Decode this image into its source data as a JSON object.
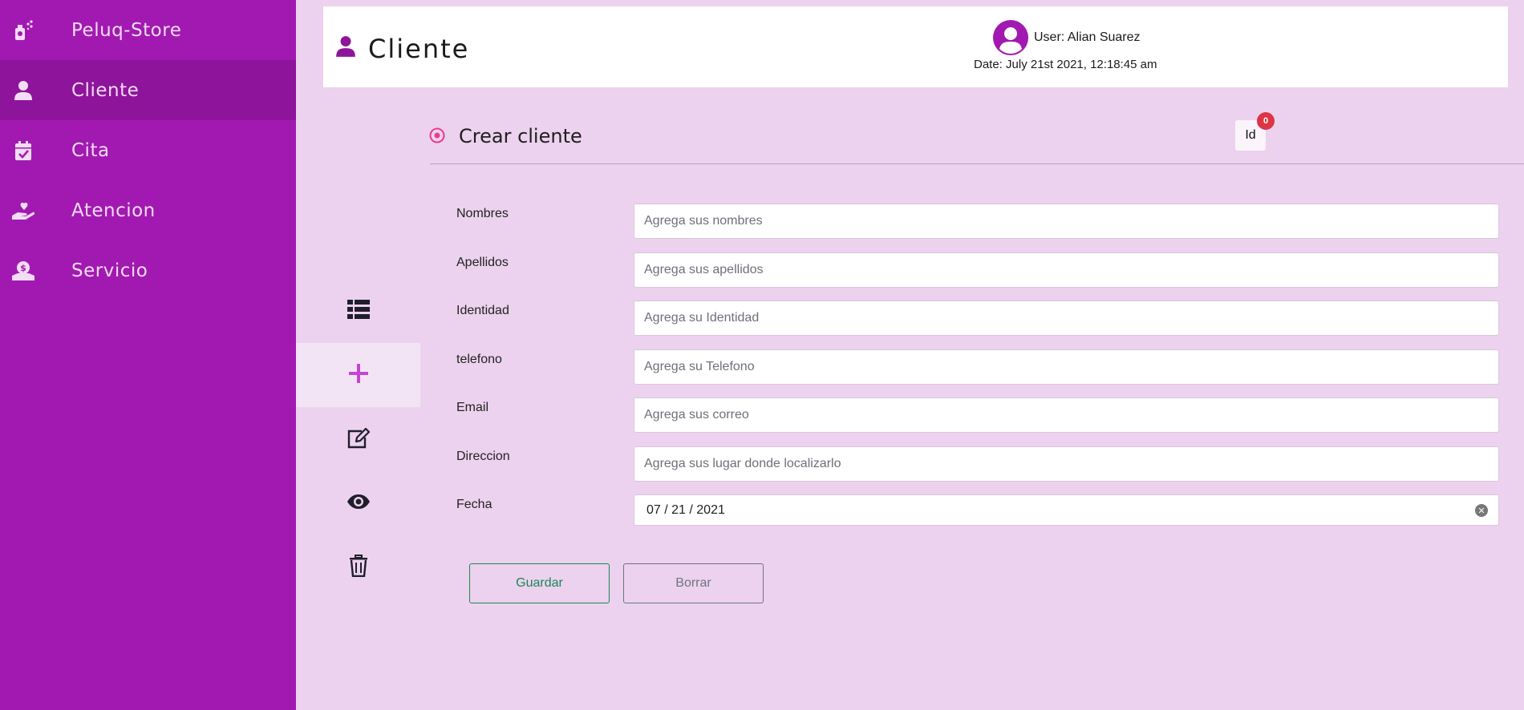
{
  "sidebar": {
    "items": [
      {
        "label": "Peluq-Store",
        "icon": "perfume-icon"
      },
      {
        "label": "Cliente",
        "icon": "user-icon",
        "active": true
      },
      {
        "label": "Cita",
        "icon": "calendar-check-icon"
      },
      {
        "label": "Atencion",
        "icon": "hand-holding-heart-icon"
      },
      {
        "label": "Servicio",
        "icon": "hand-holding-dollar-icon"
      }
    ]
  },
  "header": {
    "title": "Cliente",
    "user": "User: Alian Suarez",
    "date": "Date: July 21st 2021, 12:18:45 am"
  },
  "rail": {
    "items": [
      {
        "icon": "list-icon"
      },
      {
        "icon": "plus-icon",
        "active": true
      },
      {
        "icon": "edit-icon"
      },
      {
        "icon": "eye-icon"
      },
      {
        "icon": "trash-icon"
      }
    ]
  },
  "section": {
    "title": "Crear cliente",
    "id_label": "Id",
    "id_count": "0"
  },
  "form": {
    "nombres": {
      "label": "Nombres",
      "placeholder": "Agrega sus nombres"
    },
    "apellidos": {
      "label": "Apellidos",
      "placeholder": "Agrega sus apellidos"
    },
    "identidad": {
      "label": "Identidad",
      "placeholder": "Agrega su Identidad"
    },
    "telefono": {
      "label": "telefono",
      "placeholder": "Agrega su Telefono"
    },
    "email": {
      "label": "Email",
      "placeholder": "Agrega sus correo"
    },
    "direccion": {
      "label": "Direccion",
      "placeholder": "Agrega sus lugar donde localizarlo"
    },
    "fecha": {
      "label": "Fecha",
      "value": "07 / 21 / 2021"
    }
  },
  "buttons": {
    "save": "Guardar",
    "clear": "Borrar"
  },
  "colors": {
    "sidebar": "#a219b1",
    "sidebar_active": "#8e149b",
    "content_bg": "#ecd2ee",
    "accent": "#e83e8c"
  }
}
